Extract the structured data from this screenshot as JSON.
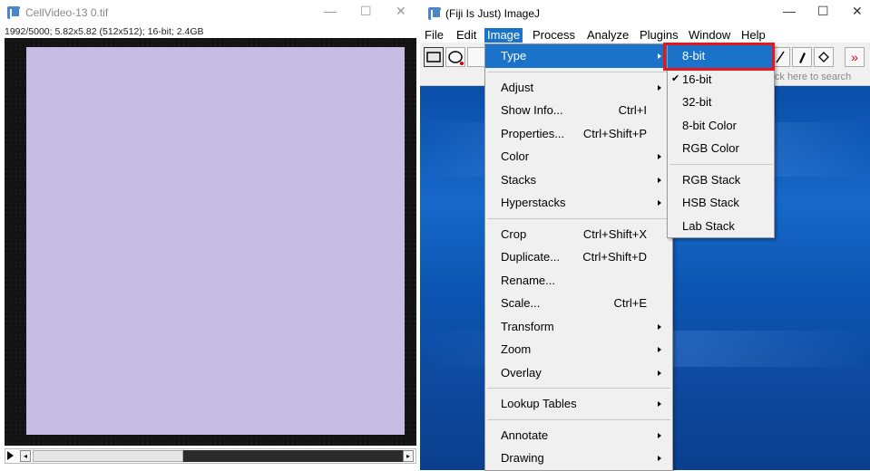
{
  "image_window": {
    "title": "CellVideo-13 0.tif",
    "info": "1992/5000; 5.82x5.82  (512x512); 16-bit; 2.4GB",
    "controls": {
      "minimize": "—",
      "maximize": "☐",
      "close": "✕"
    },
    "image_color": "#c5bde3",
    "scroll_left": "◂",
    "scroll_right": "▸"
  },
  "fiji_window": {
    "title": "(Fiji Is Just) ImageJ",
    "controls": {
      "minimize": "—",
      "maximize": "☐",
      "close": "✕"
    },
    "menubar": [
      "File",
      "Edit",
      "Image",
      "Process",
      "Analyze",
      "Plugins",
      "Window",
      "Help"
    ],
    "active_menu": "Image",
    "search_hint": "lick here to search",
    "toolbar_overflow": "»"
  },
  "image_menu": {
    "items": [
      {
        "label": "Type",
        "shortcut": "",
        "submenu": true,
        "highlighted": true
      },
      {
        "separator": true
      },
      {
        "label": "Adjust",
        "shortcut": "",
        "submenu": true
      },
      {
        "label": "Show Info...",
        "shortcut": "Ctrl+I",
        "submenu": false
      },
      {
        "label": "Properties...",
        "shortcut": "Ctrl+Shift+P",
        "submenu": false
      },
      {
        "label": "Color",
        "shortcut": "",
        "submenu": true
      },
      {
        "label": "Stacks",
        "shortcut": "",
        "submenu": true
      },
      {
        "label": "Hyperstacks",
        "shortcut": "",
        "submenu": true
      },
      {
        "separator": true
      },
      {
        "label": "Crop",
        "shortcut": "Ctrl+Shift+X",
        "submenu": false
      },
      {
        "label": "Duplicate...",
        "shortcut": "Ctrl+Shift+D",
        "submenu": false
      },
      {
        "label": "Rename...",
        "shortcut": "",
        "submenu": false
      },
      {
        "label": "Scale...",
        "shortcut": "Ctrl+E",
        "submenu": false
      },
      {
        "label": "Transform",
        "shortcut": "",
        "submenu": true
      },
      {
        "label": "Zoom",
        "shortcut": "",
        "submenu": true
      },
      {
        "label": "Overlay",
        "shortcut": "",
        "submenu": true
      },
      {
        "separator": true
      },
      {
        "label": "Lookup Tables",
        "shortcut": "",
        "submenu": true
      },
      {
        "separator": true
      },
      {
        "label": "Annotate",
        "shortcut": "",
        "submenu": true
      },
      {
        "label": "Drawing",
        "shortcut": "",
        "submenu": true
      }
    ]
  },
  "type_submenu": {
    "items": [
      {
        "label": "8-bit",
        "checked": false,
        "highlighted": true
      },
      {
        "label": "16-bit",
        "checked": true
      },
      {
        "label": "32-bit",
        "checked": false
      },
      {
        "label": "8-bit Color",
        "checked": false
      },
      {
        "label": "RGB Color",
        "checked": false
      },
      {
        "separator": true
      },
      {
        "label": "RGB Stack",
        "checked": false
      },
      {
        "label": "HSB Stack",
        "checked": false
      },
      {
        "label": "Lab Stack",
        "checked": false
      }
    ],
    "check_mark": "✔",
    "highlight_color": "#e8161c"
  }
}
